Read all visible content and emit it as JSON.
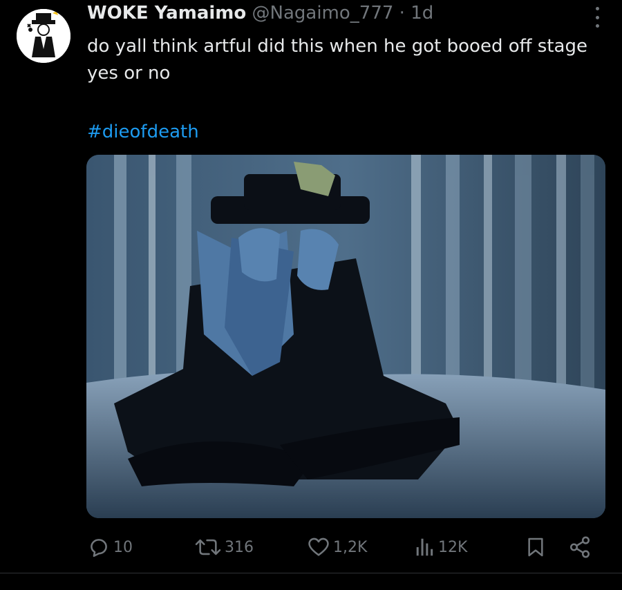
{
  "tweet": {
    "author_name": "WOKE Yamaimo",
    "handle": "@Nagaimo_777",
    "separator": "·",
    "time": "1d",
    "text": "do yall think artful did this when he got booed off stage yes or no",
    "hashtag": "#dieofdeath"
  },
  "actions": {
    "replies": "10",
    "reposts": "316",
    "likes": "1,2K",
    "views": "12K"
  },
  "colors": {
    "background": "#000000",
    "text": "#e7e9ea",
    "muted": "#71767b",
    "link": "#1d9bf0"
  }
}
